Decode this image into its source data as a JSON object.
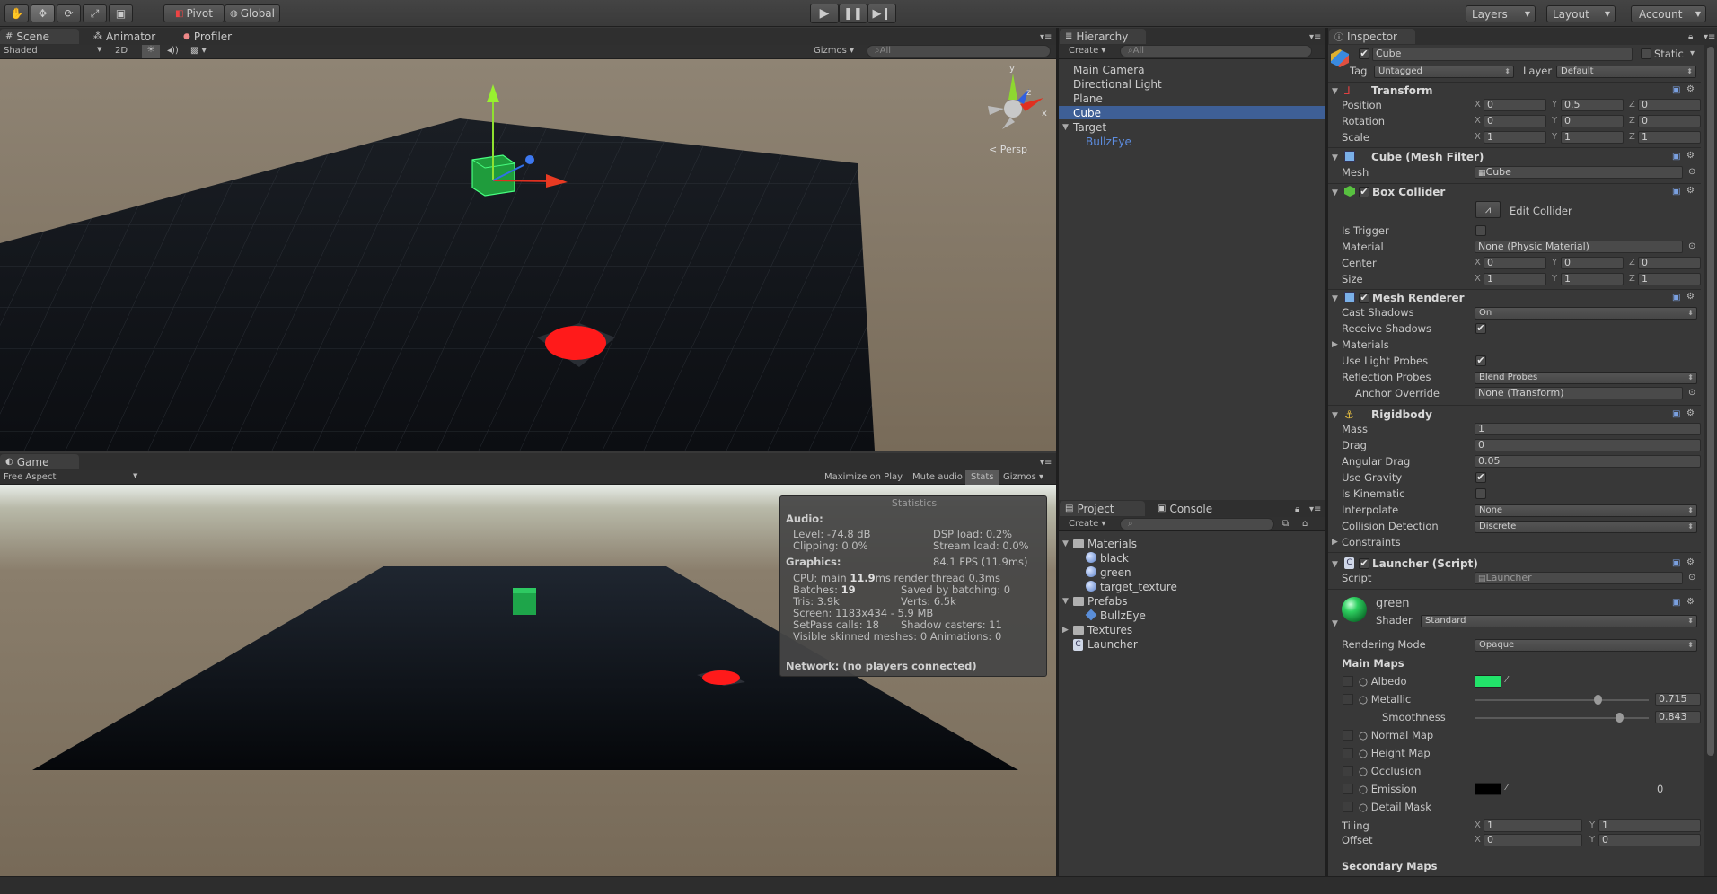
{
  "toolbar": {
    "pivot": "Pivot",
    "global": "Global",
    "layers": "Layers",
    "layout": "Layout",
    "account": "Account"
  },
  "scene": {
    "tabs": [
      "Scene",
      "Animator",
      "Profiler"
    ],
    "shading": "Shaded",
    "mode_2d": "2D",
    "gizmos": "Gizmos",
    "search": "All",
    "persp": "Persp",
    "axis_y": "y",
    "axis_z": "z",
    "axis_x": "x"
  },
  "game": {
    "tab": "Game",
    "aspect": "Free Aspect",
    "maximize": "Maximize on Play",
    "mute": "Mute audio",
    "stats": "Stats",
    "gizmos": "Gizmos"
  },
  "stats": {
    "title": "Statistics",
    "audio_hdr": "Audio:",
    "level": "Level: -74.8 dB",
    "dsp": "DSP load: 0.2%",
    "clipping": "Clipping: 0.0%",
    "stream": "Stream load: 0.0%",
    "graphics_hdr": "Graphics:",
    "fps": "84.1 FPS (11.9ms)",
    "cpu_a": "CPU: main ",
    "cpu_b": "11.9",
    "cpu_c": "ms  render thread 0.3ms",
    "batches_a": "Batches: ",
    "batches_b": "19",
    "saved": "Saved by batching: 0",
    "tris": "Tris: 3.9k",
    "verts": "Verts: 6.5k",
    "screen": "Screen: 1183x434 - 5.9 MB",
    "setpass": "SetPass calls: 18",
    "shadow": "Shadow casters: 11",
    "skinned": "Visible skinned meshes: 0  Animations: 0",
    "network": "Network: (no players connected)"
  },
  "hierarchy": {
    "tab": "Hierarchy",
    "create": "Create",
    "search": "All",
    "items": [
      "Main Camera",
      "Directional Light",
      "Plane",
      "Cube",
      "Target",
      "BullzEye"
    ]
  },
  "project": {
    "tab": "Project",
    "console_tab": "Console",
    "create": "Create",
    "items": [
      "Materials",
      "black",
      "green",
      "target_texture",
      "Prefabs",
      "BullzEye",
      "Textures",
      "Launcher"
    ]
  },
  "inspector": {
    "tab": "Inspector",
    "name": "Cube",
    "static": "Static",
    "tag_label": "Tag",
    "tag": "Untagged",
    "layer_label": "Layer",
    "layer": "Default",
    "transform": {
      "title": "Transform",
      "position": "Position",
      "pos": [
        "0",
        "0.5",
        "0"
      ],
      "rotation": "Rotation",
      "rot": [
        "0",
        "0",
        "0"
      ],
      "scale": "Scale",
      "scl": [
        "1",
        "1",
        "1"
      ]
    },
    "axes": [
      "X",
      "Y",
      "Z"
    ],
    "mesh_filter": {
      "title": "Cube (Mesh Filter)",
      "mesh_label": "Mesh",
      "mesh": "Cube"
    },
    "box_collider": {
      "title": "Box Collider",
      "edit": "Edit Collider",
      "trigger": "Is Trigger",
      "material_label": "Material",
      "material": "None (Physic Material)",
      "center": "Center",
      "center_v": [
        "0",
        "0",
        "0"
      ],
      "size": "Size",
      "size_v": [
        "1",
        "1",
        "1"
      ]
    },
    "mesh_renderer": {
      "title": "Mesh Renderer",
      "cast": "Cast Shadows",
      "cast_v": "On",
      "receive": "Receive Shadows",
      "materials": "Materials",
      "light_probes": "Use Light Probes",
      "reflection": "Reflection Probes",
      "reflection_v": "Blend Probes",
      "anchor": "Anchor Override",
      "anchor_v": "None (Transform)"
    },
    "rigidbody": {
      "title": "Rigidbody",
      "mass": "Mass",
      "mass_v": "1",
      "drag": "Drag",
      "drag_v": "0",
      "angular": "Angular Drag",
      "angular_v": "0.05",
      "gravity": "Use Gravity",
      "kinematic": "Is Kinematic",
      "interpolate": "Interpolate",
      "interpolate_v": "None",
      "collision": "Collision Detection",
      "collision_v": "Discrete",
      "constraints": "Constraints"
    },
    "launcher": {
      "title": "Launcher (Script)",
      "script_label": "Script",
      "script": "Launcher"
    },
    "material": {
      "name": "green",
      "shader_label": "Shader",
      "shader": "Standard",
      "rendering": "Rendering Mode",
      "rendering_v": "Opaque",
      "main_maps": "Main Maps",
      "albedo": "Albedo",
      "metallic": "Metallic",
      "metallic_v": "0.715",
      "smoothness": "Smoothness",
      "smoothness_v": "0.843",
      "normal": "Normal Map",
      "height": "Height Map",
      "occlusion": "Occlusion",
      "emission": "Emission",
      "emission_v": "0",
      "detail": "Detail Mask",
      "tiling": "Tiling",
      "tiling_v": [
        "1",
        "1"
      ],
      "offset": "Offset",
      "offset_v": [
        "0",
        "0"
      ],
      "secondary": "Secondary Maps",
      "albedo_color": "#22e36a",
      "metallic_level": 0.715,
      "smoothness_level": 0.843
    }
  }
}
